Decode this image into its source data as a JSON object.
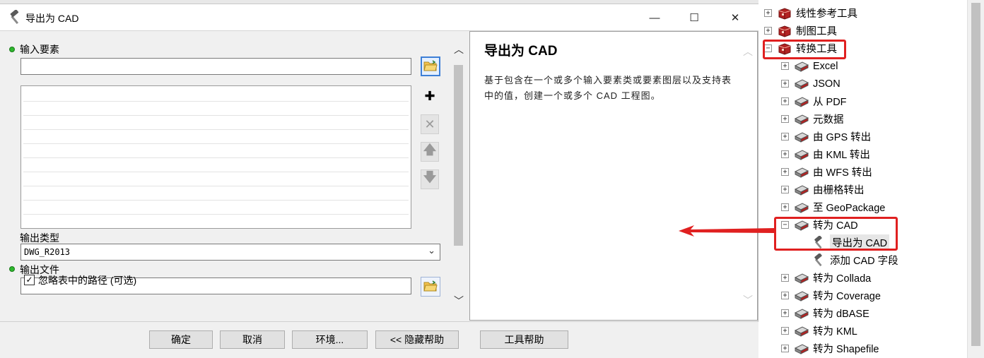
{
  "dialog": {
    "title": "导出为 CAD",
    "window_controls": {
      "minimize": "—",
      "maximize": "☐",
      "close": "✕"
    },
    "input_features": {
      "label": "输入要素",
      "value": ""
    },
    "list_rows": 9,
    "side_buttons": [
      {
        "name": "add-icon",
        "glyph": "✚"
      },
      {
        "name": "remove-icon",
        "glyph": "✕"
      },
      {
        "name": "move-up-icon",
        "glyph": "🡅"
      },
      {
        "name": "move-down-icon",
        "glyph": "🡇"
      }
    ],
    "output_type": {
      "label": "输出类型",
      "value": "DWG_R2013"
    },
    "output_file": {
      "label": "输出文件",
      "value": ""
    },
    "ignore_paths": {
      "label": "忽略表中的路径 (可选)",
      "checked": true,
      "check_glyph": "✓"
    },
    "scroll": {
      "up": "︿",
      "down": "﹀"
    },
    "help": {
      "title": "导出为  CAD",
      "body": "基于包含在一个或多个输入要素类或要素图层以及支持表中的值，创建一个或多个 CAD 工程图。"
    },
    "footer": {
      "ok": "确定",
      "cancel": "取消",
      "env": "环境...",
      "hide_help": "<< 隐藏帮助",
      "tool_help": "工具帮助"
    }
  },
  "tree": {
    "toolsets_top": [
      {
        "label": "线性参考工具",
        "expander": "+"
      },
      {
        "label": "制图工具",
        "expander": "+"
      },
      {
        "label": "转换工具",
        "expander": "−"
      }
    ],
    "conversion_children": [
      {
        "label": "Excel",
        "expander": "+"
      },
      {
        "label": "JSON",
        "expander": "+"
      },
      {
        "label": "从 PDF",
        "expander": "+"
      },
      {
        "label": "元数据",
        "expander": "+"
      },
      {
        "label": "由 GPS 转出",
        "expander": "+"
      },
      {
        "label": "由 KML 转出",
        "expander": "+"
      },
      {
        "label": "由 WFS 转出",
        "expander": "+"
      },
      {
        "label": "由栅格转出",
        "expander": "+"
      },
      {
        "label": "至 GeoPackage",
        "expander": "+"
      },
      {
        "label": "转为 CAD",
        "expander": "−"
      }
    ],
    "cad_tools": [
      {
        "label": "导出为 CAD"
      },
      {
        "label": "添加 CAD 字段"
      }
    ],
    "more_toolsets": [
      {
        "label": "转为 Collada",
        "expander": "+"
      },
      {
        "label": "转为 Coverage",
        "expander": "+"
      },
      {
        "label": "转为 dBASE",
        "expander": "+"
      },
      {
        "label": "转为 KML",
        "expander": "+"
      },
      {
        "label": "转为 Shapefile",
        "expander": "+"
      }
    ]
  },
  "colors": {
    "highlight": "#e02020",
    "required_dot": "#2eb82e",
    "toolbox_red": "#b22222"
  }
}
